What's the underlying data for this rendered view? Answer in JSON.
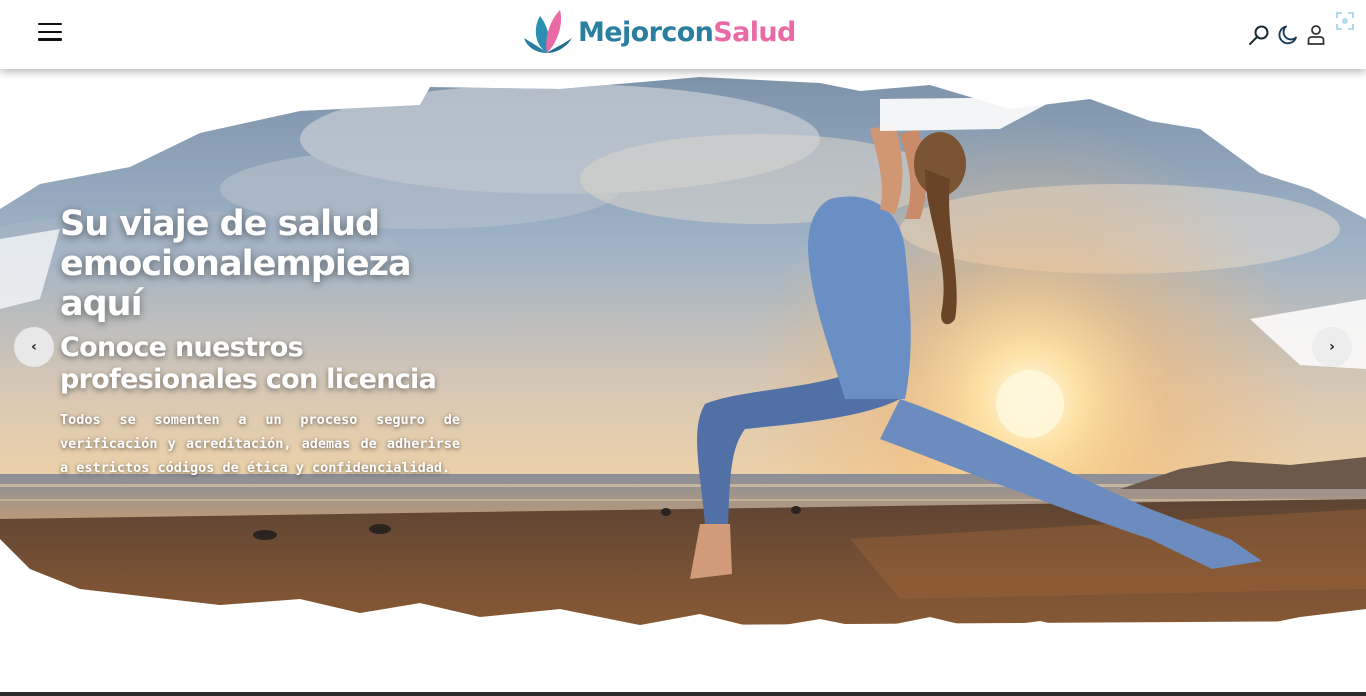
{
  "header": {
    "menu_icon": "hamburger-menu-icon",
    "logo": {
      "part1": "Mejor",
      "part2": "con",
      "part3": "Salud",
      "colors": {
        "primary": "#2a7fa0",
        "accent": "#ea6aa6"
      }
    },
    "icons": [
      "search-icon",
      "moon-icon",
      "user-icon"
    ]
  },
  "hero": {
    "title": "Su viaje de salud emocionalempieza aquí",
    "subtitle": "Conoce nuestros profesionales con licencia",
    "description": "Todos se somenten a un proceso seguro de verificación y acreditación, ademas de adherirse a estrictos códigos de ética y confidencialidad.",
    "prev_label": "‹",
    "next_label": "›"
  }
}
